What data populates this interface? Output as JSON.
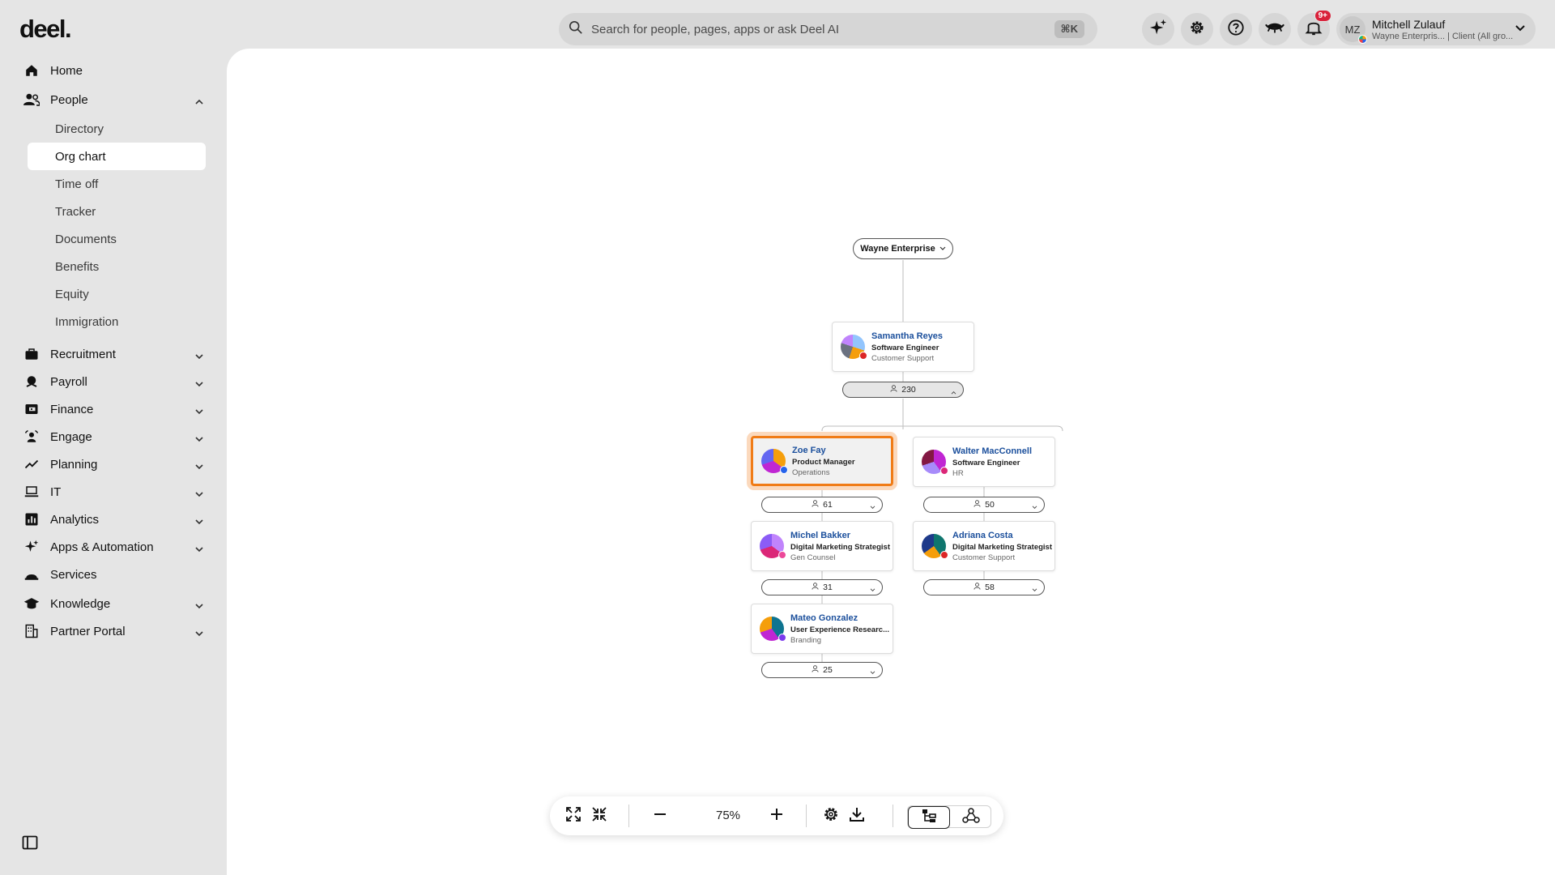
{
  "brand": {
    "logo": "deel."
  },
  "search": {
    "placeholder": "Search for people, pages, apps or ask Deel AI",
    "shortcut": "⌘K"
  },
  "notifications": {
    "badge": "9+"
  },
  "user": {
    "initials": "MZ",
    "name": "Mitchell Zulauf",
    "subtitle": "Wayne Enterpris... | Client (All gro..."
  },
  "nav": {
    "home": "Home",
    "people": "People",
    "people_sub": [
      "Directory",
      "Org chart",
      "Time off",
      "Tracker",
      "Documents",
      "Benefits",
      "Equity",
      "Immigration"
    ],
    "recruitment": "Recruitment",
    "payroll": "Payroll",
    "finance": "Finance",
    "engage": "Engage",
    "planning": "Planning",
    "it": "IT",
    "analytics": "Analytics",
    "apps": "Apps & Automation",
    "services": "Services",
    "knowledge": "Knowledge",
    "partner": "Partner Portal"
  },
  "org": {
    "company": "Wayne Enterprise",
    "root": {
      "name": "Samantha Reyes",
      "title": "Software Engineer",
      "dept": "Customer Support",
      "count": "230"
    },
    "people": [
      {
        "name": "Zoe Fay",
        "title": "Product Manager",
        "dept": "Operations",
        "count": "61",
        "colors": [
          "#f59e0b",
          "#c026d3",
          "#6366f1"
        ],
        "mini": "#2563eb"
      },
      {
        "name": "Walter MacConnell",
        "title": "Software Engineer",
        "dept": "HR",
        "count": "50",
        "colors": [
          "#c026d3",
          "#a78bfa",
          "#831843"
        ],
        "mini": "#db2777"
      },
      {
        "name": "Michel Bakker",
        "title": "Digital Marketing Strategist",
        "dept": "Gen Counsel",
        "count": "31",
        "colors": [
          "#c084fc",
          "#db2777",
          "#8b5cf6"
        ],
        "mini": "#ec4899"
      },
      {
        "name": "Adriana Costa",
        "title": "Digital Marketing Strategist",
        "dept": "Customer Support",
        "count": "58",
        "colors": [
          "#0f766e",
          "#f59e0b",
          "#1e3a8a"
        ],
        "mini": "#dc2626"
      },
      {
        "name": "Mateo Gonzalez",
        "title": "User Experience Researc...",
        "dept": "Branding",
        "count": "25",
        "colors": [
          "#0e7490",
          "#c026d3",
          "#f59e0b"
        ],
        "mini": "#7c3aed"
      }
    ]
  },
  "toolbar": {
    "zoom": "75%"
  },
  "colors": {
    "accent_selected": "#f07c17",
    "name_link": "#1b4f9c",
    "badge": "#d9213a"
  }
}
